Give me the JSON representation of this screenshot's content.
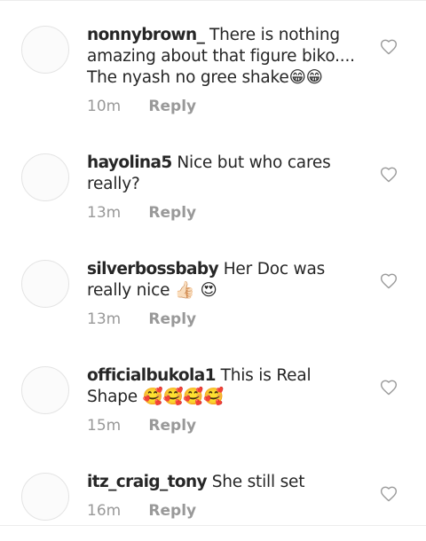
{
  "comments": [
    {
      "username": "nonnybrown_",
      "text": "There is nothing amazing about that figure biko.... The nyash no gree shake😁😁",
      "time": "10m",
      "reply": "Reply",
      "like_icon": "heart-outline-icon"
    },
    {
      "username": "hayolina5",
      "text": "Nice but who cares really?",
      "time": "13m",
      "reply": "Reply",
      "like_icon": "heart-outline-icon"
    },
    {
      "username": "silverbossbaby",
      "text": "Her Doc was really nice 👍🏻 😍",
      "time": "13m",
      "reply": "Reply",
      "like_icon": "heart-outline-icon"
    },
    {
      "username": "officialbukola1",
      "text": "This is Real Shape 🥰🥰🥰🥰",
      "time": "15m",
      "reply": "Reply",
      "like_icon": "heart-outline-icon"
    },
    {
      "username": "itz_craig_tony",
      "text": "She still set",
      "time": "16m",
      "reply": "Reply",
      "like_icon": "heart-outline-icon"
    }
  ],
  "colors": {
    "text": "#262626",
    "secondary": "#999999",
    "divider": "#ececec"
  }
}
